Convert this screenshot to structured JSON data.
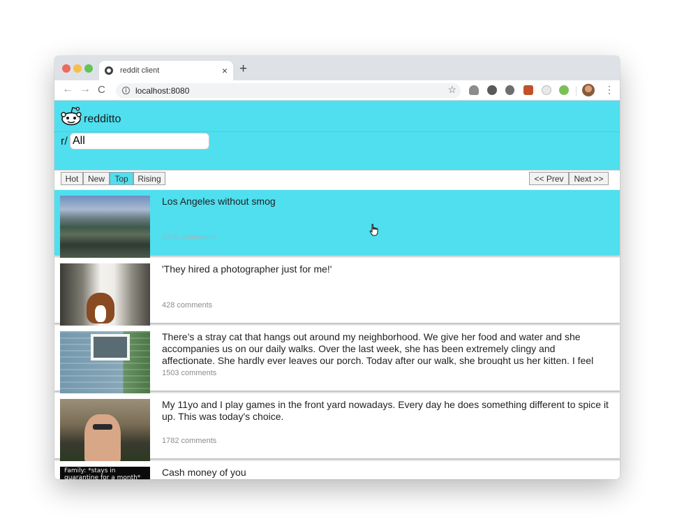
{
  "browser": {
    "tab_title": "reddit client",
    "tab_close": "×",
    "new_tab": "+",
    "back": "←",
    "forward": "→",
    "reload": "C",
    "info": "i",
    "url": "localhost:8080",
    "star": "☆",
    "menu": "⋮"
  },
  "app": {
    "brand": "redditto",
    "subreddit_prefix": "r/",
    "subreddit_value": "All",
    "accent_color": "#4fdfef"
  },
  "sort": {
    "hot": "Hot",
    "new": "New",
    "top": "Top",
    "rising": "Rising",
    "active": "Top"
  },
  "pagination": {
    "prev": "<< Prev",
    "next": "Next >>"
  },
  "posts": [
    {
      "title": "Los Angeles without smog",
      "comments": "2970 comments",
      "thumb": "city-photo"
    },
    {
      "title": "'They hired a photographer just for me!'",
      "comments": "428 comments",
      "thumb": "dog-photo"
    },
    {
      "title": "There’s a stray cat that hangs out around my neighborhood. We give her food and water and she accompanies us on our daily walks. Over the last week, she has been extremely clingy and affectionate. She hardly ever leaves our porch. Today after our walk, she brought us her kitten. I feel",
      "comments": "1503 comments",
      "thumb": "house-photo"
    },
    {
      "title": "My 11yo and I play games in the front yard nowadays. Every day he does something different to spice it up. This was today's choice.",
      "comments": "1782 comments",
      "thumb": "yard-photo"
    },
    {
      "title": "Cash money of you",
      "comments": "",
      "thumb": "meme-image",
      "thumb_text": "Family: *stays in quarantine for a month*"
    }
  ]
}
